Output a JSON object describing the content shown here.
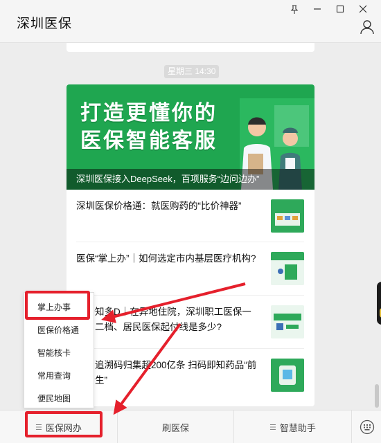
{
  "window": {
    "title": "深圳医保",
    "controls": [
      "pin-icon",
      "minimize-icon",
      "maximize-icon",
      "close-icon"
    ],
    "user_icon": "user-icon"
  },
  "chat": {
    "timestamp": "星期三 14:30",
    "article": {
      "banner_line1": "打造更懂你的",
      "banner_line2": "医保智能客服",
      "banner_caption": "深圳医保接入DeepSeek，百项服务“边问边办”",
      "items": [
        {
          "text": "深圳医保价格通：就医购药的“比价神器”"
        },
        {
          "text": "医保“掌上办”｜如何选定市内基层医疗机构?"
        },
        {
          "text": "科普知多D｜在异地住院，深圳职工医保一档、二档、居民医保起付线是多少?"
        },
        {
          "text": "药品追溯码归集超200亿条 扫码即知药品“前世今生”"
        }
      ]
    }
  },
  "popup_menu": {
    "items": [
      "掌上办事",
      "医保价格通",
      "智能核卡",
      "常用查询",
      "便民地图"
    ]
  },
  "bottom_menu": {
    "tabs": [
      "医保网办",
      "刷医保",
      "智慧助手"
    ],
    "keyboard_icon": "keyboard-icon"
  },
  "colors": {
    "brand_green": "#1fa650",
    "annotation_red": "#e5202c"
  }
}
